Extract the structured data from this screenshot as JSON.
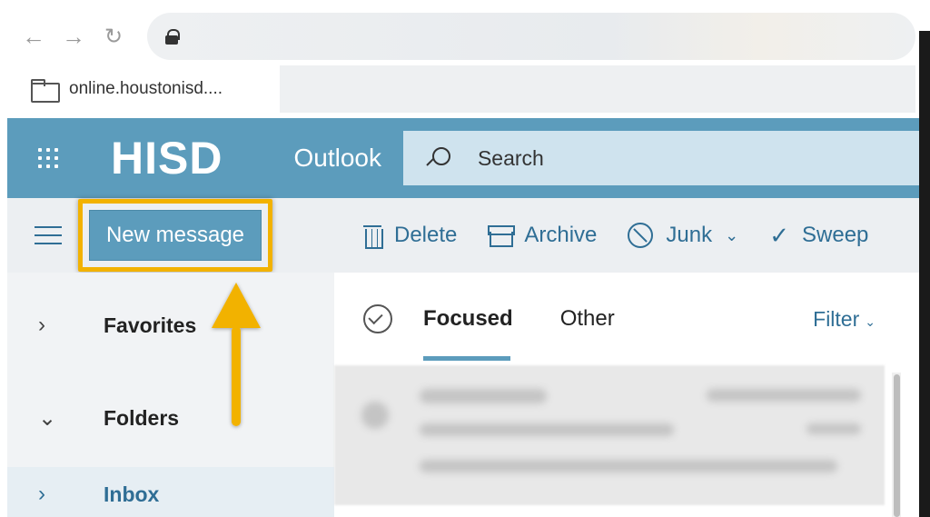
{
  "browser": {
    "tab_title": "online.houstonisd....",
    "url": ""
  },
  "header": {
    "brand": "HISD",
    "app_name": "Outlook",
    "search_placeholder": "Search"
  },
  "toolbar": {
    "new_message_label": "New message",
    "delete_label": "Delete",
    "archive_label": "Archive",
    "junk_label": "Junk",
    "sweep_label": "Sweep"
  },
  "sidebar": {
    "items": [
      {
        "label": "Favorites",
        "expanded": false
      },
      {
        "label": "Folders",
        "expanded": true
      },
      {
        "label": "Inbox",
        "expanded": false,
        "selected": true
      }
    ]
  },
  "message_list": {
    "tabs": [
      {
        "label": "Focused",
        "active": true
      },
      {
        "label": "Other",
        "active": false
      }
    ],
    "filter_label": "Filter"
  },
  "colors": {
    "brand_blue": "#5c9cbc",
    "highlight_yellow": "#f2b200",
    "link_blue": "#2f6e95"
  },
  "icons": {
    "back": "arrow-left-icon",
    "forward": "arrow-right-icon",
    "reload": "reload-icon",
    "lock": "lock-icon",
    "folder": "folder-icon",
    "app_launcher": "waffle-icon",
    "search": "search-icon",
    "menu": "hamburger-icon",
    "delete": "trash-icon",
    "archive": "archive-icon",
    "junk": "block-icon",
    "sweep": "broom-icon",
    "select_all": "check-circle-icon"
  }
}
